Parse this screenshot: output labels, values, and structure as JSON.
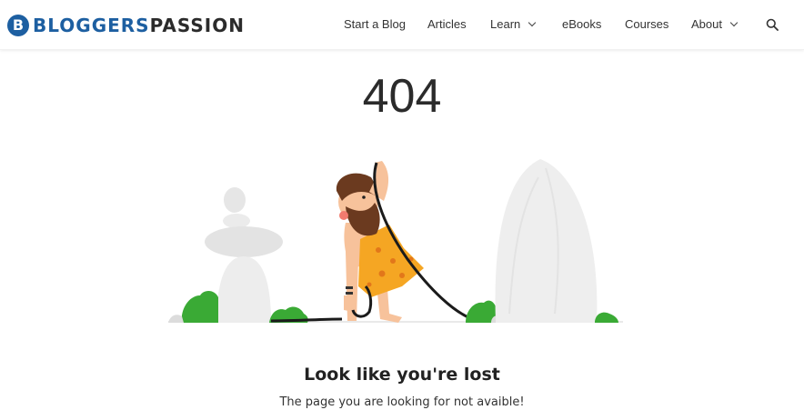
{
  "brand": {
    "badge_letter": "B",
    "name_part_1": "BLOGGERS",
    "name_part_2": "PASSION",
    "colors": {
      "blue": "#1d5fa1",
      "dark": "#2b2b2b"
    }
  },
  "nav": {
    "items": [
      {
        "label": "Start a Blog",
        "has_dropdown": false
      },
      {
        "label": "Articles",
        "has_dropdown": false
      },
      {
        "label": "Learn",
        "has_dropdown": true
      },
      {
        "label": "eBooks",
        "has_dropdown": false
      },
      {
        "label": "Courses",
        "has_dropdown": false
      },
      {
        "label": "About",
        "has_dropdown": true
      }
    ],
    "search_icon": "search-icon"
  },
  "error": {
    "code": "404",
    "heading": "Look like you're lost",
    "message": "The page you are looking for not avaible!"
  },
  "illustration": {
    "subject": "caveman-with-cable-illustration",
    "colors": {
      "rock": "#ececec",
      "bush": "#3aaa35",
      "skin": "#f7c29b",
      "hair": "#6b3a1f",
      "leopard": "#f5a623",
      "cable": "#1b1b1b"
    }
  }
}
